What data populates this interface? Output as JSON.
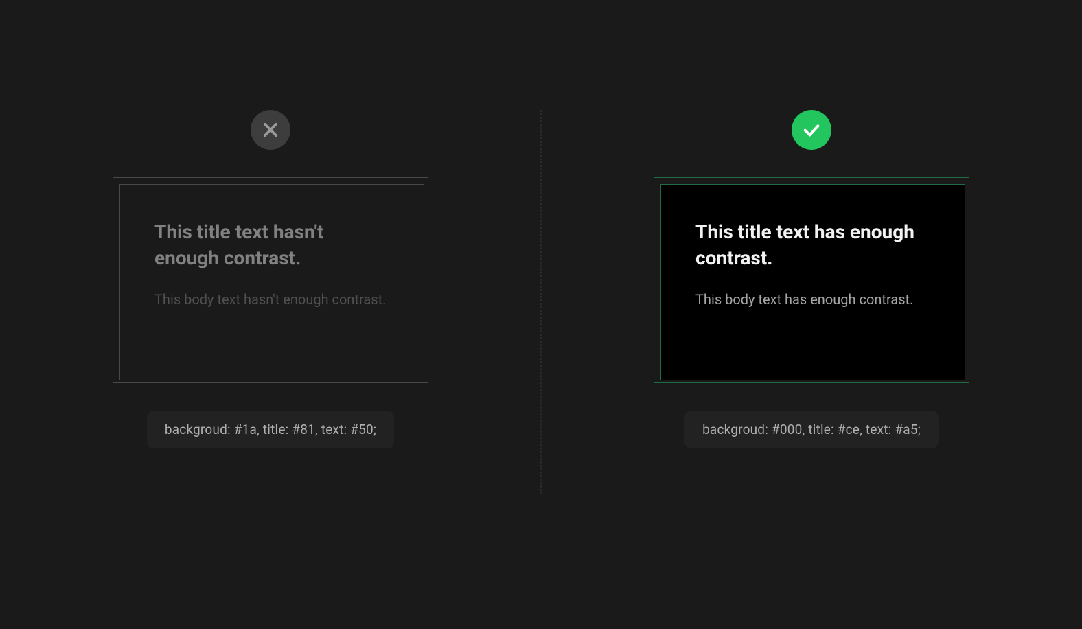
{
  "badExample": {
    "title": "This title text hasn't enough contrast.",
    "body": "This body text hasn't enough contrast.",
    "code": "backgroud: #1a, title: #81, text: #50;"
  },
  "goodExample": {
    "title": "This title text has enough contrast.",
    "body": "This body text has enough contrast.",
    "code": "backgroud: #000, title: #ce, text: #a5;"
  },
  "colors": {
    "pageBackground": "#1a1a1a",
    "badBackground": "#1a1a1a",
    "badTitle": "#818181",
    "badText": "#505050",
    "goodBackground": "#000000",
    "goodTitle": "#cecece",
    "goodText": "#a5a5a5",
    "successGreen": "#22c55e",
    "failGray": "#3d3d3d"
  }
}
